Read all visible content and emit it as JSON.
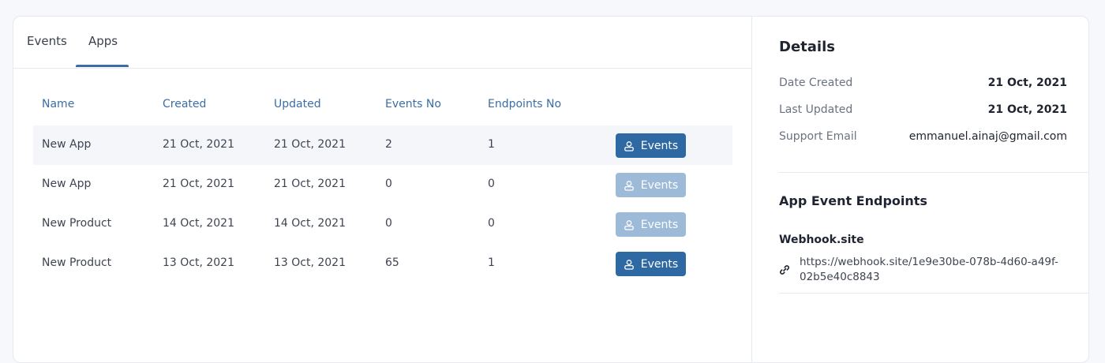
{
  "tabs": [
    {
      "label": "Events",
      "active": false
    },
    {
      "label": "Apps",
      "active": true
    }
  ],
  "table": {
    "columns": [
      "Name",
      "Created",
      "Updated",
      "Events No",
      "Endpoints No"
    ],
    "rows": [
      {
        "name": "New App",
        "created": "21 Oct, 2021",
        "updated": "21 Oct, 2021",
        "events_no": "2",
        "endpoints_no": "1",
        "button": "Events",
        "enabled": true
      },
      {
        "name": "New App",
        "created": "21 Oct, 2021",
        "updated": "21 Oct, 2021",
        "events_no": "0",
        "endpoints_no": "0",
        "button": "Events",
        "enabled": false
      },
      {
        "name": "New Product",
        "created": "14 Oct, 2021",
        "updated": "14 Oct, 2021",
        "events_no": "0",
        "endpoints_no": "0",
        "button": "Events",
        "enabled": false
      },
      {
        "name": "New Product",
        "created": "13 Oct, 2021",
        "updated": "13 Oct, 2021",
        "events_no": "65",
        "endpoints_no": "1",
        "button": "Events",
        "enabled": true
      }
    ]
  },
  "details": {
    "title": "Details",
    "date_created_label": "Date Created",
    "date_created": "21 Oct, 2021",
    "last_updated_label": "Last Updated",
    "last_updated": "21 Oct, 2021",
    "support_email_label": "Support Email",
    "support_email": "emmanuel.ainaj@gmail.com"
  },
  "endpoints": {
    "title": "App Event Endpoints",
    "items": [
      {
        "name": "Webhook.site",
        "url": "https://webhook.site/1e9e30be-078b-4d60-a49f-02b5e40c8843",
        "icon": "link-icon"
      }
    ]
  },
  "colors": {
    "accent": "#3a6ea5",
    "button": "#2f69a4",
    "button_disabled": "#9dbbd9",
    "highlight_row": "#f4f6fa"
  }
}
